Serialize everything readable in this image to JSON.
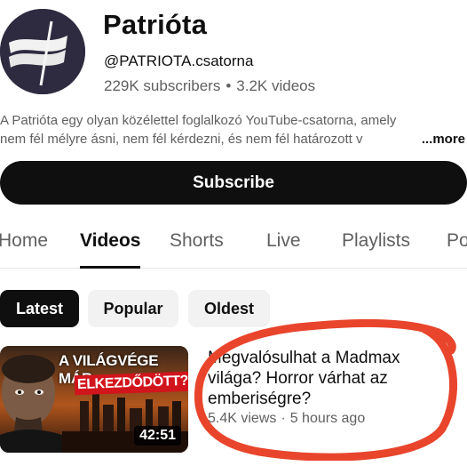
{
  "channel": {
    "name": "Patrióta",
    "handle": "@PATRIOTA.csatorna",
    "subscribers": "229K subscribers",
    "videos": "3.2K videos",
    "separator": "•",
    "description_line1": "A Patrióta egy olyan közélettel foglalkozó YouTube-csatorna, amely",
    "description_line2": "nem fél mélyre ásni, nem fél kérdezni, és nem fél határozott v",
    "more_label": "...more"
  },
  "subscribe_label": "Subscribe",
  "tabs": [
    {
      "label": "Home",
      "active": false
    },
    {
      "label": "Videos",
      "active": true
    },
    {
      "label": "Shorts",
      "active": false
    },
    {
      "label": "Live",
      "active": false
    },
    {
      "label": "Playlists",
      "active": false
    },
    {
      "label": "Po",
      "active": false
    }
  ],
  "filters": [
    {
      "label": "Latest",
      "selected": true
    },
    {
      "label": "Popular",
      "selected": false
    },
    {
      "label": "Oldest",
      "selected": false
    }
  ],
  "video": {
    "thumbnail_line1": "A VILÁGVÉGE MÁR",
    "thumbnail_line2": "ELKEZDŐDÖTT?",
    "duration": "42:51",
    "title": "Megvalósulhat a Madmax világa? Horror várhat az emberiségre?",
    "views": "5.4K views",
    "separator": "·",
    "age": "5 hours ago"
  },
  "colors": {
    "annotation_circle": "#e8452c",
    "accent_red": "#d2141c",
    "primary": "#0f0f0f",
    "secondary_text": "#606060"
  },
  "icons": {
    "avatar": "flag-logo-icon"
  }
}
